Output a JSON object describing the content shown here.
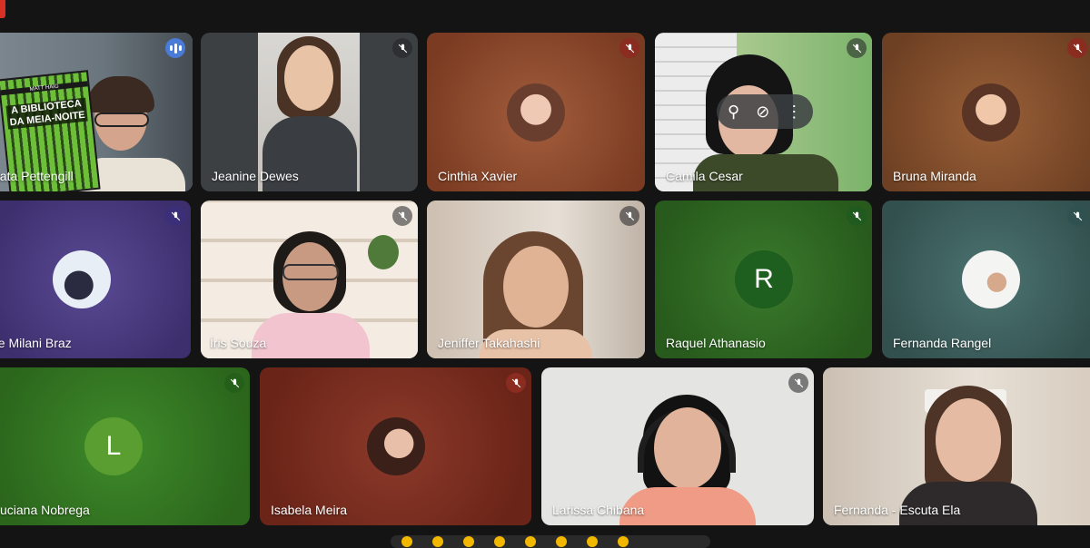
{
  "meeting": {
    "participants": [
      {
        "name": "nata Pettengill",
        "book_title": "A BIBLIOTECA DA MEIA-NOITE",
        "book_author": "MATT HAIG",
        "status": "speaking"
      },
      {
        "name": "Jeanine Dewes",
        "status": "muted"
      },
      {
        "name": "Cinthia Xavier",
        "status": "muted"
      },
      {
        "name": "Camila Cesar",
        "status": "muted"
      },
      {
        "name": "Bruna Miranda",
        "status": "muted"
      },
      {
        "name": "ne Milani Braz",
        "status": "muted"
      },
      {
        "name": "Íris Souza",
        "status": "muted"
      },
      {
        "name": "Jeniffer Takahashi",
        "status": "muted"
      },
      {
        "name": "Raquel Athanasio",
        "initial": "R",
        "status": "muted"
      },
      {
        "name": "Fernanda Rangel",
        "status": "muted"
      },
      {
        "name": "uciana Nobrega",
        "initial": "L",
        "status": "muted"
      },
      {
        "name": "Isabela Meira",
        "status": "muted"
      },
      {
        "name": "Larissa Chibana",
        "status": "muted"
      },
      {
        "name": "Fernanda - Escuta Ela",
        "status": "muted"
      }
    ]
  },
  "colors": {
    "background": "#141414",
    "speaking_border": "#8ab4f8",
    "brown_tile": "#8a4a2c",
    "purple_tile": "#4a3d7e",
    "green_tile": "#2f5e1f",
    "teal_tile": "#3d5f5d",
    "red_tile": "#7a2d22",
    "letter_R": "#1e5e1e",
    "letter_L": "#5a9e32"
  },
  "icons": [
    "mic-off-icon",
    "speaking-icon",
    "pin-icon",
    "more-options-icon",
    "reaction-emoji-icon"
  ]
}
